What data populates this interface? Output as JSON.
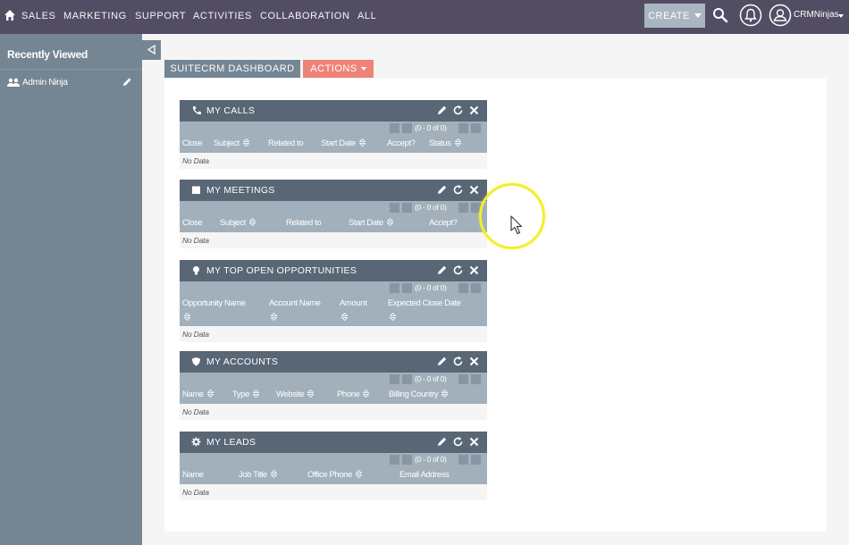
{
  "nav": {
    "items": [
      "SALES",
      "MARKETING",
      "SUPPORT",
      "ACTIVITIES",
      "COLLABORATION",
      "ALL"
    ],
    "create_label": "CREATE",
    "user_name": "CRMNinjas",
    "home_icon": "home-icon",
    "search_icon": "search-icon",
    "alert_icon": "bell-icon",
    "user_icon": "user-icon"
  },
  "sidebar": {
    "title": "Recently Viewed",
    "items": [
      {
        "label": "Admin Ninja",
        "icon": "people-icon"
      }
    ]
  },
  "tabs": {
    "dashboard": "SUITECRM DASHBOARD",
    "actions": "ACTIONS"
  },
  "dashlets": [
    {
      "title": "MY CALLS",
      "icon": "phone-icon",
      "pager": "(0 - 0 of 0)",
      "columns": [
        "Close",
        "Subject",
        "Related to",
        "Start Date",
        "Accept?",
        "Status"
      ],
      "empty": "No Data"
    },
    {
      "title": "MY MEETINGS",
      "icon": "calendar-icon",
      "pager": "(0 - 0 of 0)",
      "columns": [
        "Close",
        "Subject",
        "Related to",
        "Start Date",
        "Accept?"
      ],
      "empty": "No Data"
    },
    {
      "title": "MY TOP OPEN OPPORTUNITIES",
      "icon": "lightbulb-icon",
      "pager": "(0 - 0 of 0)",
      "columns": [
        "Opportunity Name",
        "Account Name",
        "Amount",
        "Expected Close Date"
      ],
      "empty": "No Data"
    },
    {
      "title": "MY ACCOUNTS",
      "icon": "shield-icon",
      "pager": "(0 - 0 of 0)",
      "columns": [
        "Name",
        "Type",
        "Website",
        "Phone",
        "Billing Country"
      ],
      "empty": "No Data"
    },
    {
      "title": "MY LEADS",
      "icon": "gear-icon",
      "pager": "(0 - 0 of 0)",
      "columns": [
        "Name",
        "Job Title",
        "Office Phone",
        "Email Address"
      ],
      "empty": "No Data"
    }
  ],
  "colors": {
    "topbar": "#534d64",
    "sidebar": "#748593",
    "dashlet_header": "#596676",
    "dashlet_columns": "#a2b0bb",
    "actions": "#f08377",
    "cursor_highlight": "#f1ef2c"
  }
}
